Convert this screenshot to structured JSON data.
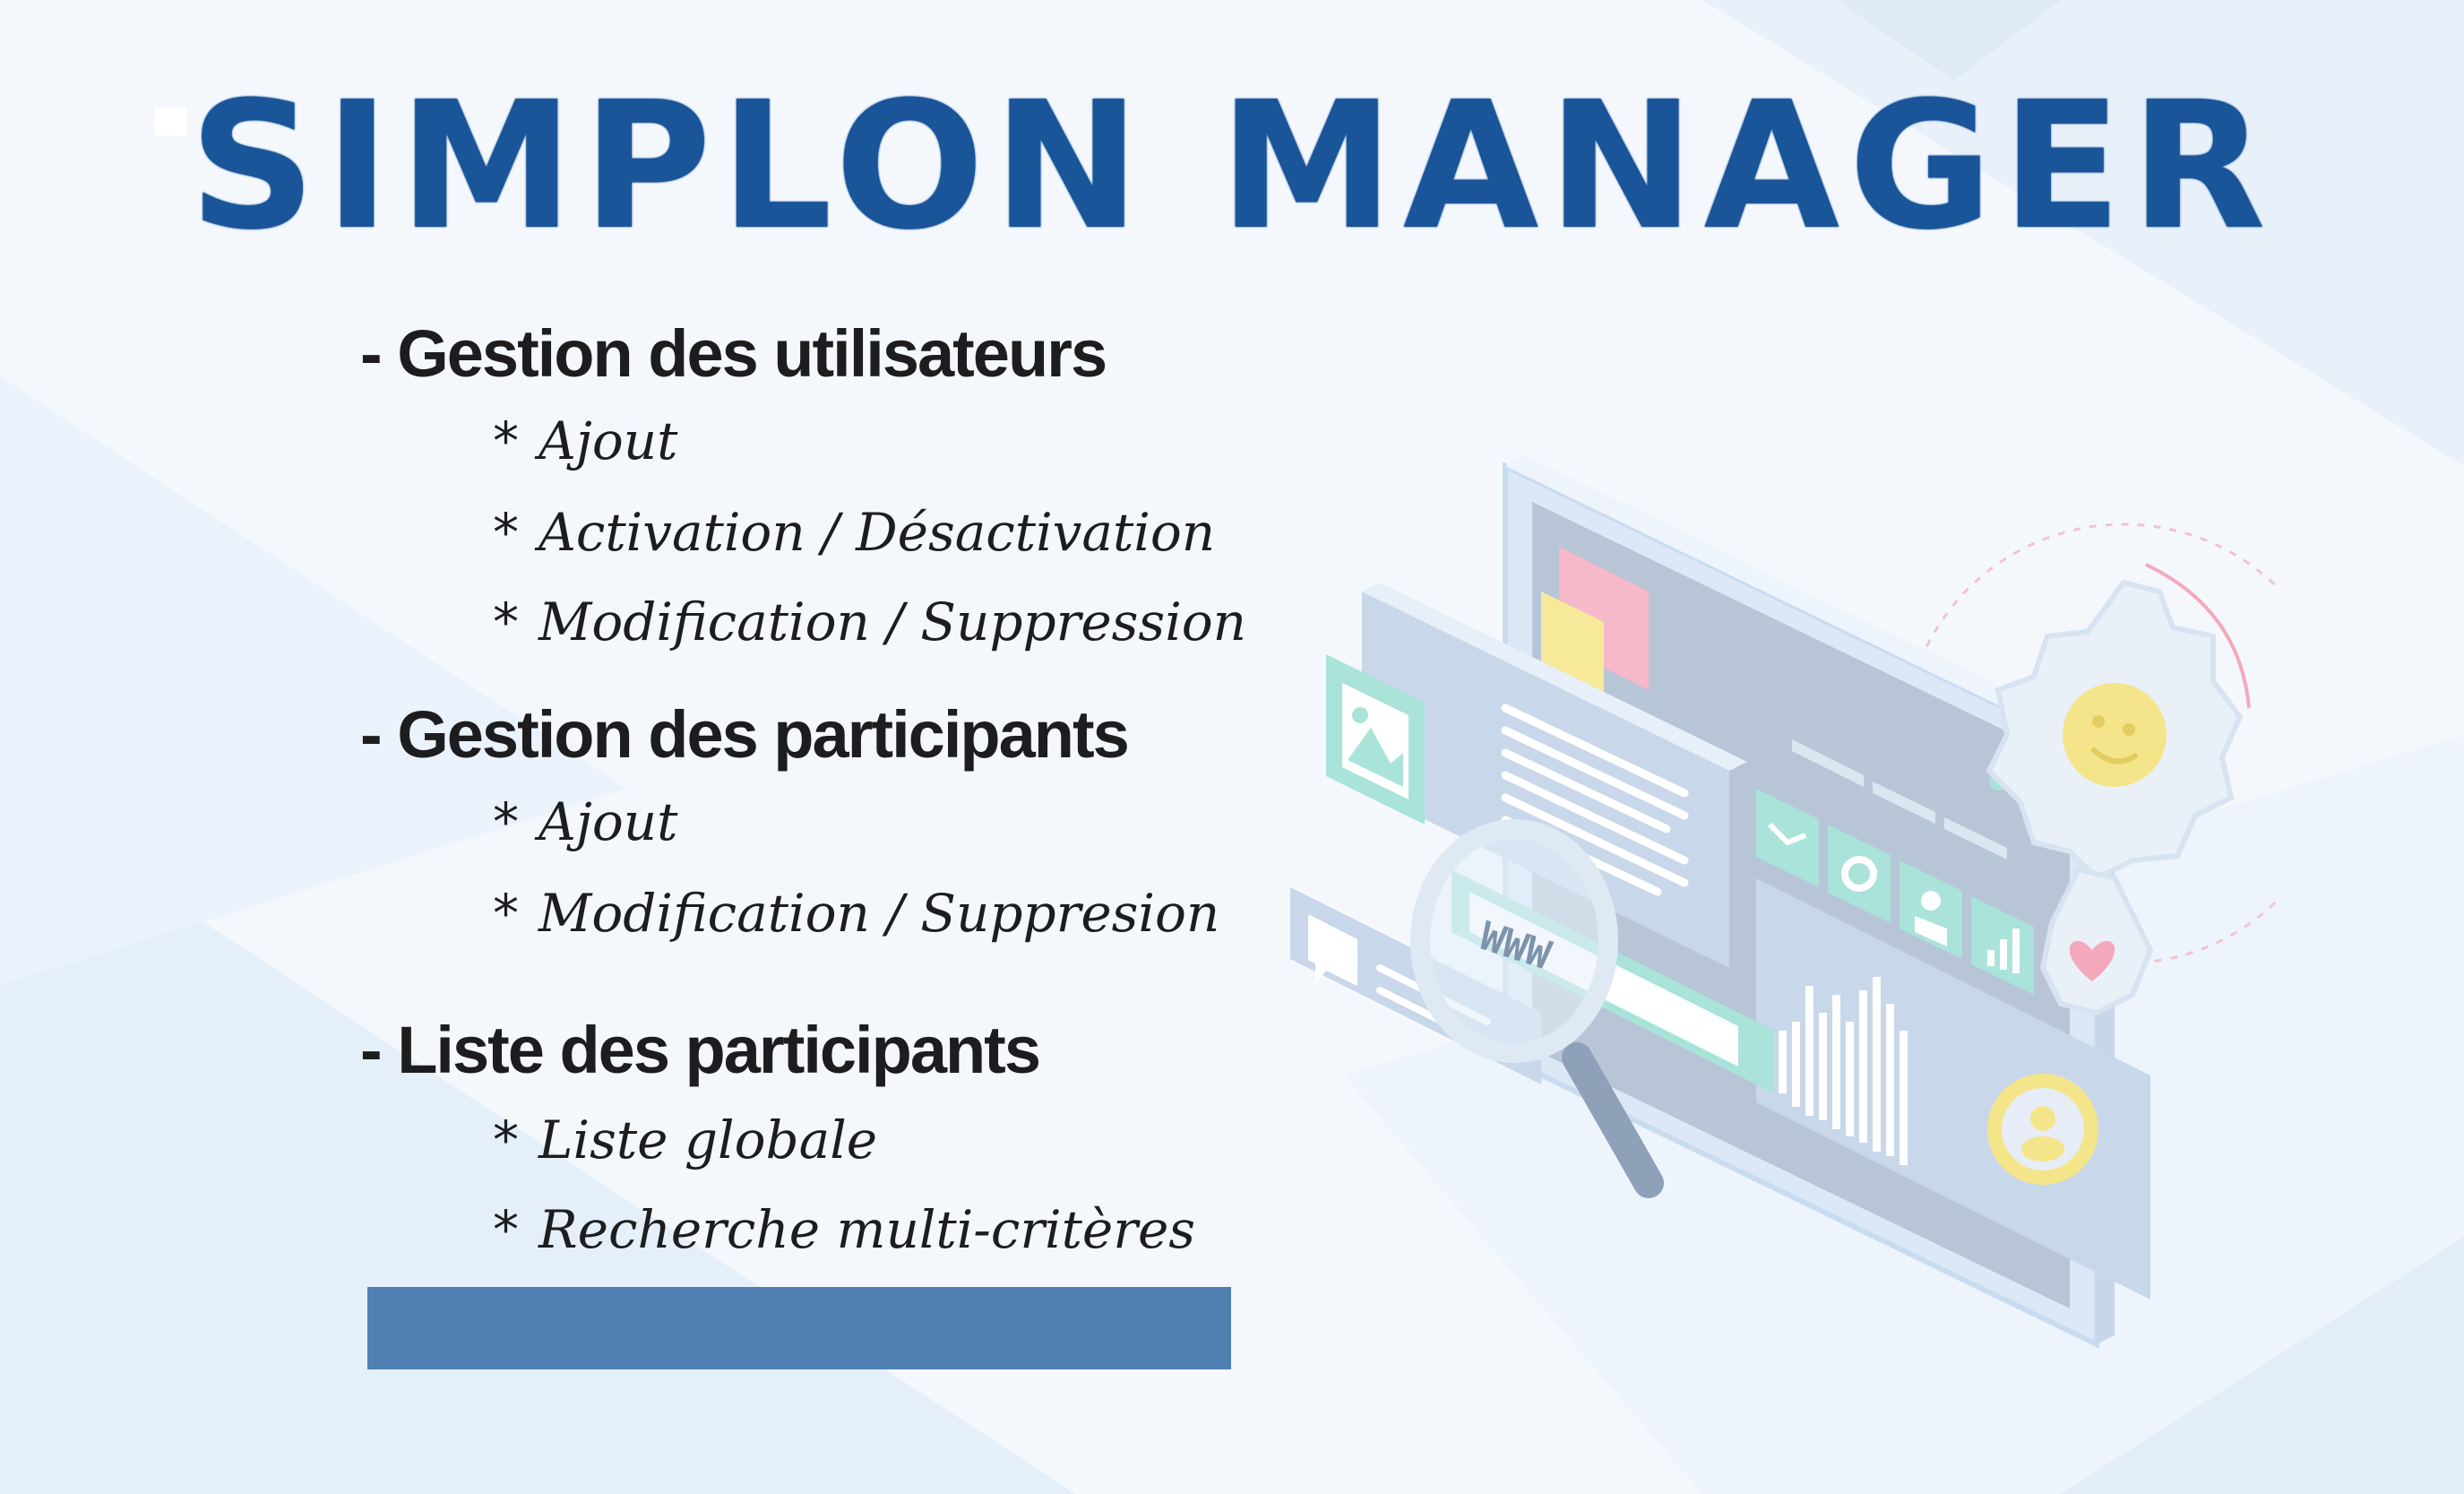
{
  "title": "SIMPLON MANAGER",
  "sections": [
    {
      "heading": "- Gestion des utilisateurs",
      "items": [
        "Ajout",
        "Activation / Désactivation",
        "Modification / Suppression"
      ]
    },
    {
      "heading": "- Gestion des participants",
      "items": [
        "Ajout",
        "Modification / Suppresion"
      ]
    },
    {
      "heading": "- Liste des participants",
      "items": [
        "Liste globale",
        "Recherche multi-critères"
      ]
    }
  ],
  "bullet": "*",
  "illustration": {
    "search_text": "WWW",
    "icons": [
      "image-icon",
      "chat-icon",
      "mail-icon",
      "gear-icon",
      "user-icon",
      "bar-chart-icon",
      "smiley-icon",
      "heart-icon",
      "magnifier-icon"
    ]
  },
  "colors": {
    "title": "#1a5599",
    "text": "#1d1d1f",
    "bar": "#5080b2",
    "background": "#f4f8fd"
  }
}
